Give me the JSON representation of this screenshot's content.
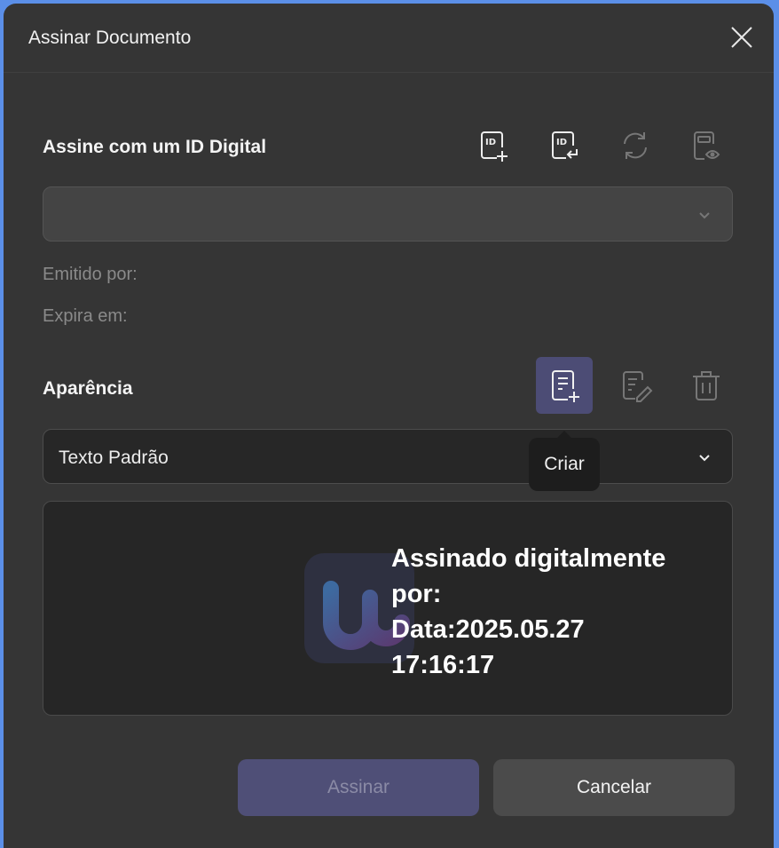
{
  "dialog": {
    "title": "Assinar Documento"
  },
  "digital_id": {
    "section_title": "Assine com um ID Digital",
    "icons": [
      "id-add-icon",
      "id-import-icon",
      "refresh-icon",
      "id-view-icon"
    ],
    "selected_value": "",
    "issued_by_label": "Emitido por:",
    "expires_label": "Expira em:"
  },
  "appearance": {
    "section_title": "Aparência",
    "icons": [
      "create-appearance-icon",
      "edit-appearance-icon",
      "trash-icon"
    ],
    "selected_value": "Texto Padrão",
    "tooltip": "Criar",
    "preview": {
      "line1": "Assinado digitalmente",
      "line2": "por:",
      "line3": "Data:2025.05.27",
      "line4": "17:16:17"
    }
  },
  "buttons": {
    "sign": "Assinar",
    "cancel": "Cancelar"
  },
  "colors": {
    "dialog_bg": "#353535",
    "accent": "#4f4f77",
    "frame": "#5b8fe8"
  }
}
